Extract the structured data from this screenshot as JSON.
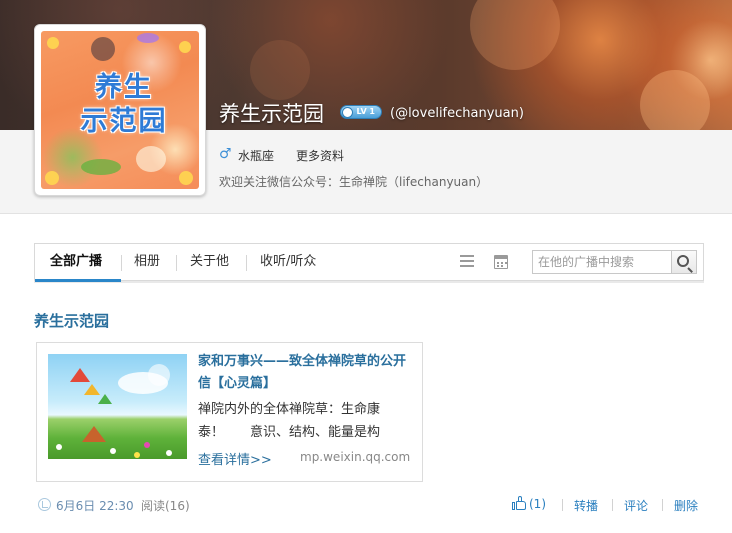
{
  "profile": {
    "name": "养生示范园",
    "level_badge": "LV 1",
    "handle": "(@lovelifechanyuan)",
    "zodiac": "水瓶座",
    "more_info": "更多资料",
    "bio": "欢迎关注微信公众号：生命禅院（lifechanyuan）",
    "avatar_text_line1": "养生",
    "avatar_text_line2": "示范园"
  },
  "icons": {
    "gender": "male-icon",
    "level": "level-badge-icon",
    "list_view": "list-view-icon",
    "calendar": "calendar-icon",
    "search": "search-icon",
    "like": "thumbs-up-icon",
    "time": "clock-icon"
  },
  "tabs": [
    {
      "label": "全部广播",
      "active": true
    },
    {
      "label": "相册",
      "active": false
    },
    {
      "label": "关于他",
      "active": false
    },
    {
      "label": "收听/听众",
      "active": false
    }
  ],
  "search": {
    "placeholder": "在他的广播中搜索"
  },
  "feed": {
    "author": "养生示范园",
    "card": {
      "title": "家和万事兴——致全体禅院草的公开信【心灵篇】",
      "excerpt": "禅院内外的全体禅院草：生命康泰！　　意识、结构、能量是构",
      "link": "查看详情>>",
      "source": "mp.weixin.qq.com"
    },
    "meta": {
      "time": "6月6日 22:30",
      "reads": "阅读(16)"
    },
    "actions": {
      "like_count": "(1)",
      "repost": "转播",
      "comment": "评论",
      "delete": "删除"
    }
  },
  "colors": {
    "link": "#2a6f9d",
    "accent": "#2a86c9",
    "avatar_bg": "#f38a52",
    "avatar_text": "#2f7bd6"
  }
}
